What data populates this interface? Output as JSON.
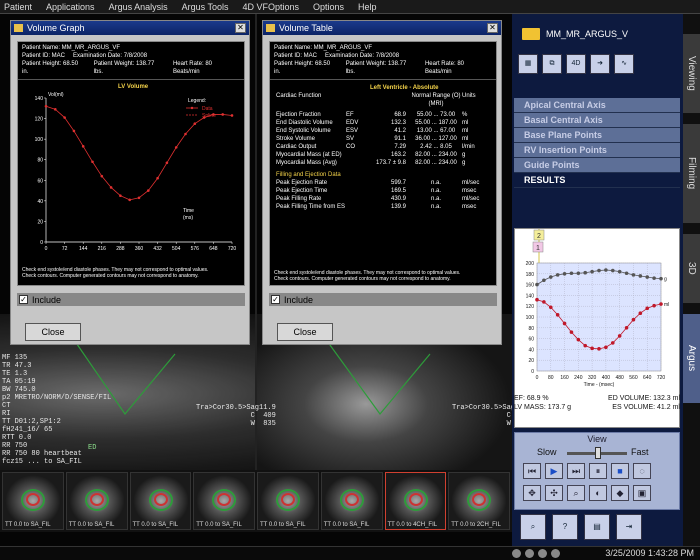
{
  "menu": [
    "Patient",
    "Applications",
    "Argus Analysis",
    "Argus Tools",
    "4D VFOptions",
    "Options",
    "Help"
  ],
  "volume_graph": {
    "title": "Volume Graph",
    "patient_name": "Patient Name:  MM_MR_ARGUS_VF",
    "patient_id": "Patient ID:  MAC",
    "exam_date": "Examination Date:  7/8/2008",
    "height": "Patient Height:  68.50 in.",
    "weight": "Patient Weight:  138.77 lbs.",
    "heart_rate": "Heart Rate:  80 Beats/min",
    "chart_title": "LV Volume",
    "ylabel": "Vol(ml)",
    "xlabel": "Time (ms)",
    "legend_title": "Legend:",
    "legend_data": "Data",
    "legend_spline": "Spline",
    "footnote1": "Check end systole/end diastole phases. They may not correspond to optimal values.",
    "footnote2": "Check contours. Computer generated contours may not correspond to anatomy.",
    "include": "Include",
    "close": "Close"
  },
  "volume_table": {
    "title": "Volume Table",
    "patient_name": "Patient Name:  MM_MR_ARGUS_VF",
    "patient_id": "Patient ID:  MAC",
    "exam_date": "Examination Date:  7/8/2008",
    "height": "Patient Height:  68.50 in.",
    "weight": "Patient Weight:  138.77 lbs.",
    "heart_rate": "Heart Rate:  80 Beats/min",
    "section_title": "Left Ventricle - Absolute",
    "col_function": "Cardiac Function",
    "col_range": "Normal Range (O) (MRI)",
    "col_units": "Units",
    "rows": [
      {
        "name": "Ejection Fraction",
        "abbr": "EF",
        "value": "68.9",
        "range": "55.00 ... 73.00",
        "unit": "%"
      },
      {
        "name": "End Diastolic Volume",
        "abbr": "EDV",
        "value": "132.3",
        "range": "55.00 ... 187.00",
        "unit": "ml"
      },
      {
        "name": "End Systolic Volume",
        "abbr": "ESV",
        "value": "41.2",
        "range": "13.00 ... 67.00",
        "unit": "ml"
      },
      {
        "name": "Stroke Volume",
        "abbr": "SV",
        "value": "91.1",
        "range": "36.00 ... 127.00",
        "unit": "ml"
      },
      {
        "name": "Cardiac Output",
        "abbr": "CO",
        "value": "7.29",
        "range": "2.42 ... 8.05",
        "unit": "l/min"
      },
      {
        "name": "Myocardial Mass (at ED)",
        "abbr": "",
        "value": "163.2",
        "range": "82.00 ... 234.00",
        "unit": "g"
      },
      {
        "name": "Myocardial Mass (Avg)",
        "abbr": "",
        "value": "173.7 ± 9.8",
        "range": "82.00 ... 234.00",
        "unit": "g"
      }
    ],
    "filling_title": "Filling and Ejection Data",
    "filling_rows": [
      {
        "name": "Peak Ejection Rate",
        "value": "599.7",
        "range": "n.a.",
        "unit": "ml/sec"
      },
      {
        "name": "Peak Ejection Time",
        "value": "169.5",
        "range": "n.a.",
        "unit": "msec"
      },
      {
        "name": "Peak Filling Rate",
        "value": "430.9",
        "range": "n.a.",
        "unit": "ml/sec"
      },
      {
        "name": "Peak Filling Time from ES",
        "value": "139.9",
        "range": "n.a.",
        "unit": "msec"
      }
    ],
    "footnote1": "Check end systole/end diastole phases. They may not correspond to optimal values.",
    "footnote2": "Check contours. Computer generated contours may not correspond to anatomy.",
    "include": "Include",
    "close": "Close"
  },
  "viewer": {
    "left_overlay": "MF 135\nTR 47.3\nTE 1.3\nTA 05:19\nBW 745.0\np2 MRETRO/NORM/D/SENSE/FIL\nCT\nRI\nTT D01:2,SP1:2\nfH241_16/ 65\nRTT 0.0\nRR 750\nRR 750 80 heartbeat\nfcz15 ... to SA_FIL",
    "right_overlay": "Tra>Cor30.5>Sag11.9\nC  409\nW  835",
    "ed_label": "ED"
  },
  "thumbnails": [
    {
      "label": "TT 0.0 to SA_FIL"
    },
    {
      "label": "TT 0.0 to SA_FIL"
    },
    {
      "label": "TT 0.0 to SA_FIL"
    },
    {
      "label": "TT 0.0 to SA_FIL"
    },
    {
      "label": "TT 0.0 to SA_FIL"
    },
    {
      "label": "TT 0.0 to SA_FIL"
    },
    {
      "label": "TT 0.0 to 4CH_FIL"
    },
    {
      "label": "TT 0.0 to 2CH_FIL"
    }
  ],
  "right_panel": {
    "folder": "MM_MR_ARGUS_V",
    "steps": [
      "Apical Central Axis",
      "Basal Central Axis",
      "Base Plane Points",
      "RV Insertion Points",
      "Guide Points",
      "RESULTS"
    ],
    "marker_top": "2",
    "marker_left": "1",
    "graph_xlabel": "Time - (msec)",
    "label_g": "g",
    "label_ml": "ml",
    "stats": {
      "ef": "EF: 68.9 %",
      "ed_volume": "ED VOLUME: 132.3 ml",
      "lv_mass": "LV MASS: 173.7 g",
      "es_volume": "ES VOLUME: 41.2 ml"
    },
    "view_title": "View",
    "slow": "Slow",
    "fast": "Fast"
  },
  "side_tabs": [
    "Viewing",
    "Filming",
    "3D",
    "Argus"
  ],
  "taskbar": {
    "clock": "3/25/2009 1:43:28 PM"
  },
  "chart_data": [
    {
      "type": "line",
      "title": "LV Volume",
      "xlabel": "Time (ms)",
      "ylabel": "Vol(ml)",
      "x": [
        0,
        36,
        72,
        108,
        144,
        180,
        216,
        252,
        288,
        324,
        360,
        396,
        432,
        468,
        504,
        540,
        576,
        612,
        648,
        684,
        720
      ],
      "series": [
        {
          "name": "Data",
          "values": [
            132,
            129,
            121,
            108,
            93,
            78,
            64,
            53,
            45,
            41,
            43,
            50,
            62,
            77,
            92,
            105,
            115,
            121,
            124,
            124,
            123
          ]
        },
        {
          "name": "Spline",
          "values": [
            132,
            129,
            121,
            108,
            93,
            78,
            64,
            53,
            45,
            41,
            43,
            50,
            62,
            77,
            92,
            105,
            115,
            121,
            124,
            124,
            123
          ]
        }
      ],
      "xticks": [
        0,
        72,
        144,
        216,
        288,
        360,
        432,
        504,
        576,
        648,
        720
      ],
      "yticks": [
        0,
        20,
        40,
        60,
        80,
        100,
        120,
        140
      ],
      "ylim": [
        0,
        140
      ],
      "xlim": [
        0,
        720
      ],
      "legend": "top-right",
      "grid": false
    },
    {
      "type": "line",
      "xlabel": "Time - (msec)",
      "x": [
        0,
        40,
        80,
        120,
        160,
        200,
        240,
        280,
        320,
        360,
        400,
        440,
        480,
        520,
        560,
        600,
        640,
        680,
        720
      ],
      "series": [
        {
          "name": "g",
          "values": [
            160,
            168,
            174,
            178,
            180,
            181,
            181,
            182,
            184,
            186,
            187,
            186,
            184,
            181,
            178,
            176,
            174,
            172,
            171
          ]
        },
        {
          "name": "ml",
          "values": [
            132,
            128,
            118,
            104,
            88,
            72,
            58,
            47,
            42,
            41,
            44,
            52,
            65,
            80,
            95,
            107,
            116,
            121,
            124
          ]
        }
      ],
      "xticks": [
        0,
        80,
        160,
        240,
        320,
        400,
        480,
        560,
        640,
        720
      ],
      "yticks": [
        0,
        20,
        40,
        60,
        80,
        100,
        120,
        140,
        160,
        180,
        200
      ],
      "ylim": [
        0,
        200
      ],
      "xlim": [
        0,
        720
      ],
      "grid": true
    }
  ]
}
